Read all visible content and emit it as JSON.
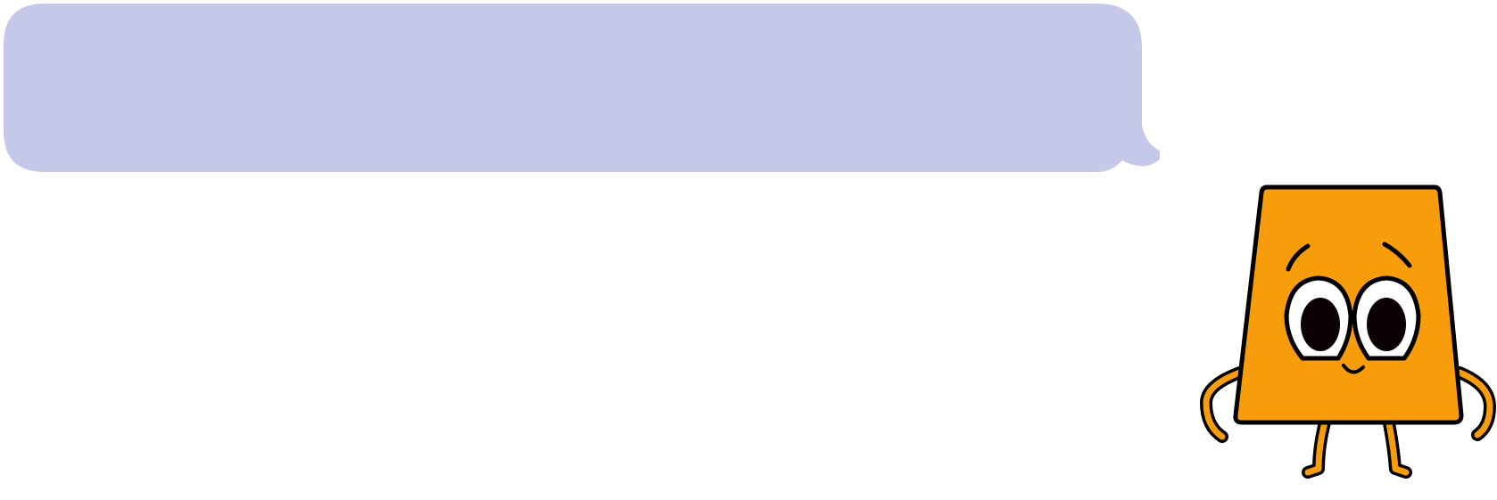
{
  "speech_bubble": {
    "text": "",
    "fill_color": "#c5c8e8"
  },
  "character": {
    "body_color": "#f79c0a",
    "outline_color": "#000000",
    "eye_pupil_color": "#0b0004"
  }
}
